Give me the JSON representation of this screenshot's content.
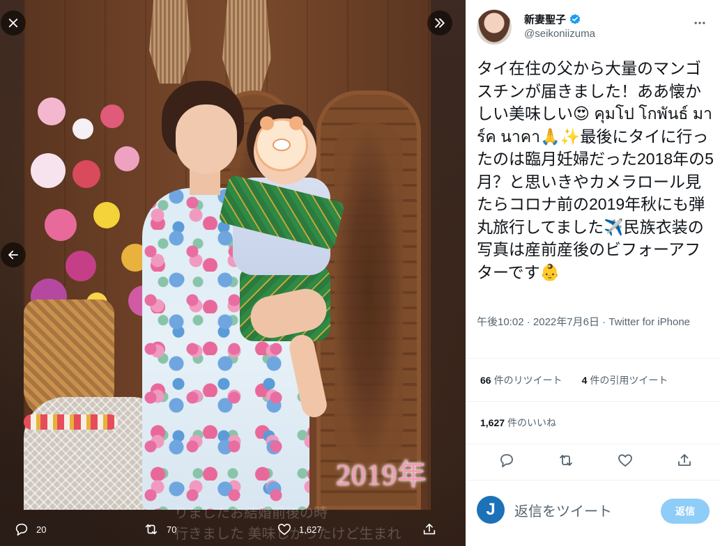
{
  "media": {
    "caption_year": "2019年",
    "reply_peek_lines": [
      "りましたお結婚前後の時",
      "行きました 美味しかったけど生まれ"
    ],
    "controls": {
      "close_icon": "close-icon",
      "expand_icon": "chevron-double-right-icon",
      "prev_icon": "arrow-left-icon"
    },
    "actions": {
      "reply_count": "20",
      "retweet_count": "70",
      "like_count": "1,627"
    }
  },
  "tweet": {
    "display_name": "新妻聖子",
    "handle": "@seikoniizuma",
    "text": "タイ在住の父から大量のマンゴスチンが届きました！ああ懐かしい美味しい😍 คุมโป โกพันธ์ มาร์ค นาคา🙏✨最後にタイに行ったのは臨月妊婦だった2018年の5月？と思いきやカメラロール見たらコロナ前の2019年秋にも弾丸旅行してました✈️民族衣装の写真は産前産後のビフォーアフターです👶",
    "time": "午後10:02",
    "date": "2022年7月6日",
    "separator": "·",
    "source": "Twitter for iPhone"
  },
  "stats": {
    "retweets_num": "66",
    "retweets_label": "件のリツイート",
    "quotes_num": "4",
    "quotes_label": "件の引用ツイート",
    "likes_num": "1,627",
    "likes_label": "件のいいね"
  },
  "reply": {
    "avatar_letter": "J",
    "placeholder": "返信をツイート",
    "button_label": "返信"
  },
  "colors": {
    "verified": "#1d9bf0",
    "reply_button": "#8ecdf8",
    "caption": "#f29ab7"
  }
}
